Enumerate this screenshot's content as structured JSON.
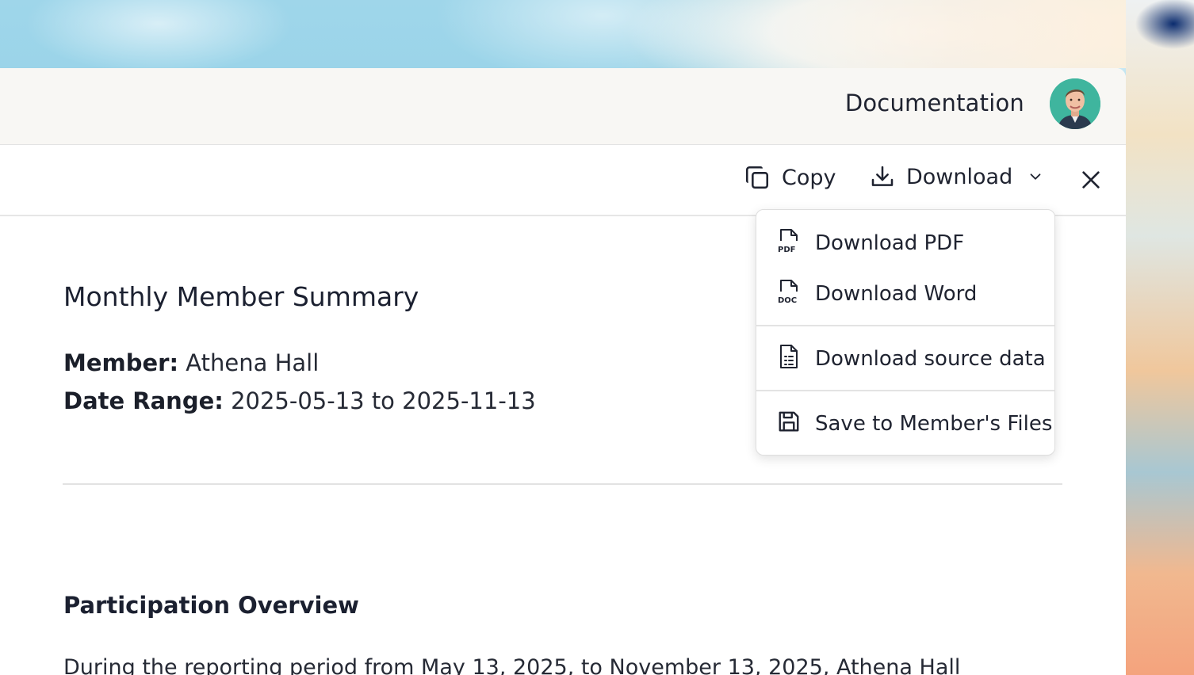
{
  "header": {
    "documentation_label": "Documentation"
  },
  "toolbar": {
    "copy_label": "Copy",
    "download_label": "Download"
  },
  "download_menu": {
    "items": [
      {
        "label": "Download PDF",
        "icon": "file-pdf-icon"
      },
      {
        "label": "Download Word",
        "icon": "file-doc-icon"
      },
      {
        "label": "Download source data",
        "icon": "file-spreadsheet-icon"
      },
      {
        "label": "Save to Member's Files",
        "icon": "floppy-disk-icon"
      }
    ]
  },
  "document": {
    "title": "Monthly Member Summary",
    "member_key": "Member:",
    "member_value": "Athena Hall",
    "date_range_key": "Date Range:",
    "date_range_value": "2025-05-13 to 2025-11-13",
    "section_title": "Participation Overview",
    "paragraph_start": "During the reporting period from May 13, 2025, to November 13, 2025, Athena Hall"
  },
  "colors": {
    "avatar_bg": "#3fb59e",
    "topbar_bg": "#f8f7f4"
  }
}
